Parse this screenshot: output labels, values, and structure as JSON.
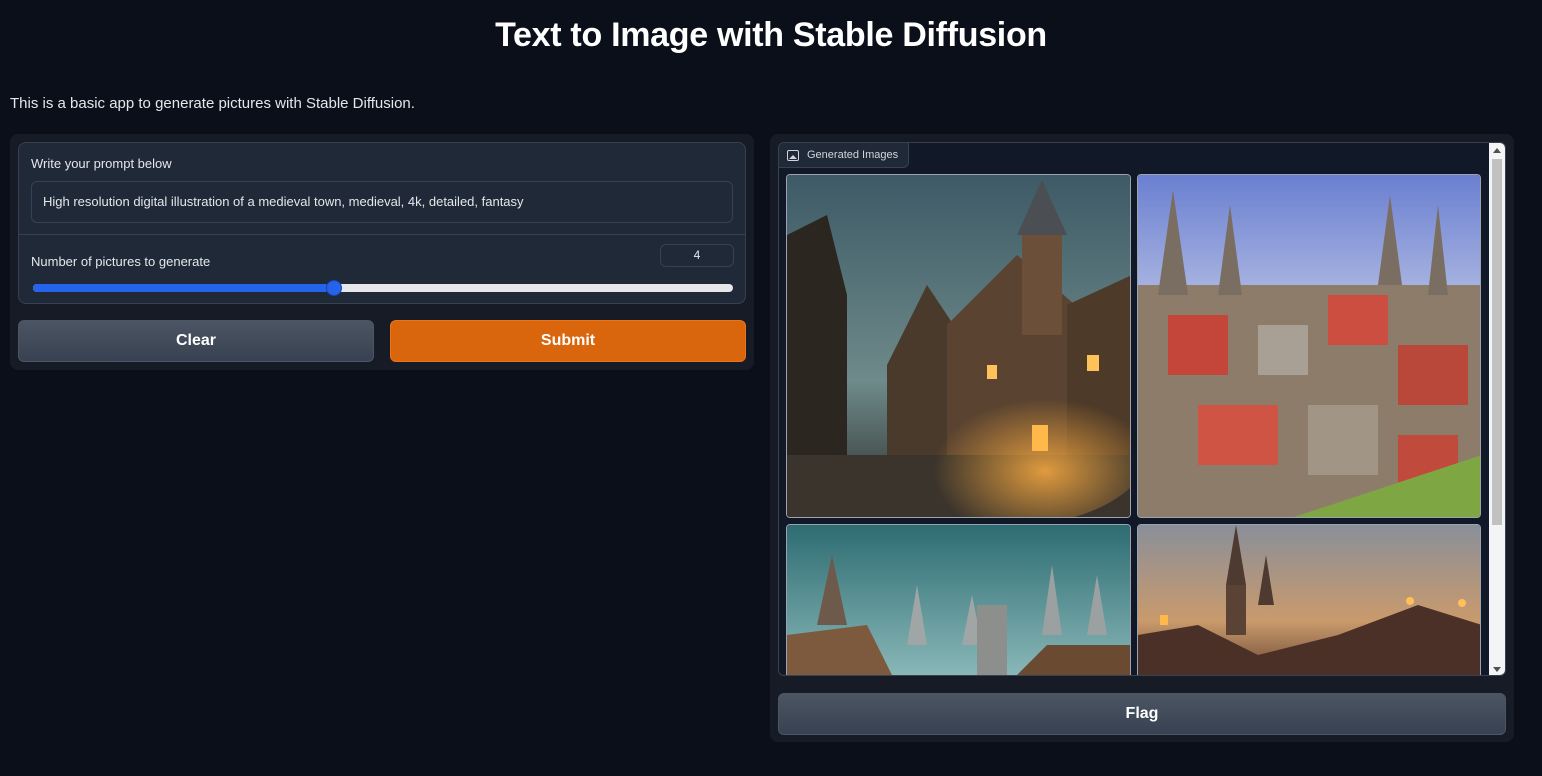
{
  "header": {
    "title": "Text to Image with Stable Diffusion",
    "description": "This is a basic app to generate pictures with Stable Diffusion."
  },
  "form": {
    "prompt_label": "Write your prompt below",
    "prompt_value": "High resolution digital illustration of a medieval town, medieval, 4k, detailed, fantasy",
    "num_label": "Number of pictures to generate",
    "num_value": "4",
    "slider_fraction": 0.43
  },
  "buttons": {
    "clear": "Clear",
    "submit": "Submit",
    "flag": "Flag"
  },
  "gallery": {
    "label": "Generated Images",
    "icon": "image-icon",
    "image_count": 4
  },
  "colors": {
    "background": "#0b0f19",
    "submit": "#d9650c",
    "slider": "#2563eb"
  }
}
